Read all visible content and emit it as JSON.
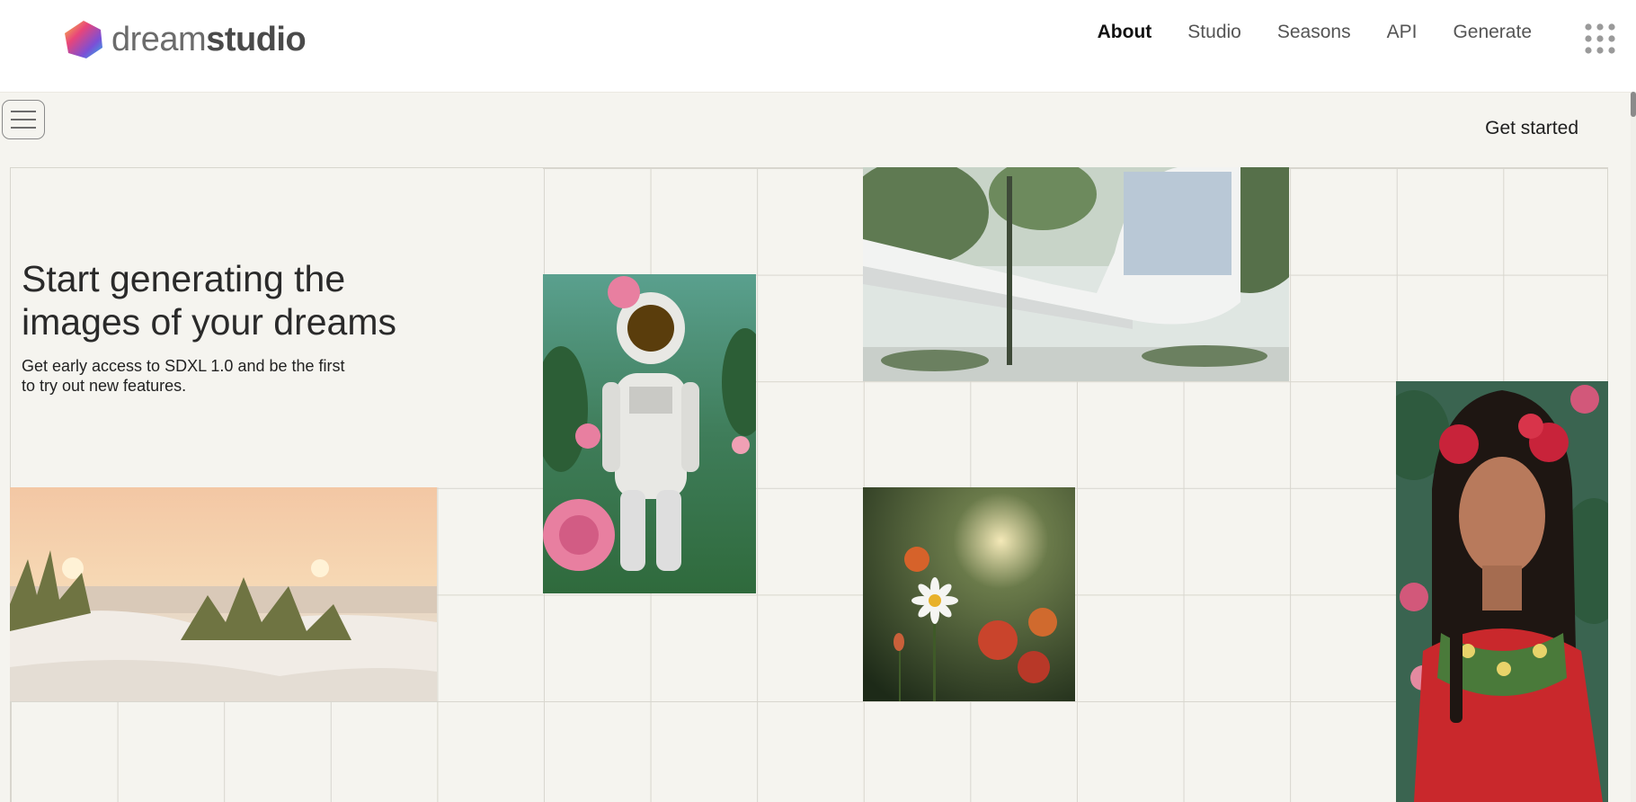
{
  "brand": {
    "name_part1": "dream",
    "name_part2": "studio",
    "colors": [
      "#f5c542",
      "#e8457a",
      "#7b4fd6",
      "#2bb5e6"
    ]
  },
  "nav": {
    "items": [
      {
        "label": "About",
        "active": true
      },
      {
        "label": "Studio",
        "active": false
      },
      {
        "label": "Seasons",
        "active": false
      },
      {
        "label": "API",
        "active": false
      },
      {
        "label": "Generate",
        "active": false
      }
    ],
    "apps_icon": "grid-dots-icon"
  },
  "menu_icon": "hamburger-menu-icon",
  "cta": {
    "get_started": "Get started"
  },
  "hero": {
    "title_line1": "Start generating the",
    "title_line2": "images of your dreams",
    "subtitle_line1": "Get early access to SDXL 1.0 and be the first",
    "subtitle_line2": "to try out new features."
  },
  "gallery": [
    {
      "name": "astronaut-roses-image"
    },
    {
      "name": "modern-house-image"
    },
    {
      "name": "beach-dunes-sunset-image"
    },
    {
      "name": "daisy-flower-image"
    },
    {
      "name": "woman-portrait-flowers-image"
    }
  ],
  "colors": {
    "background": "#f5f4ef",
    "grid_line": "#d8d6ce",
    "nav_active": "#111111",
    "nav_inactive": "#555555"
  }
}
